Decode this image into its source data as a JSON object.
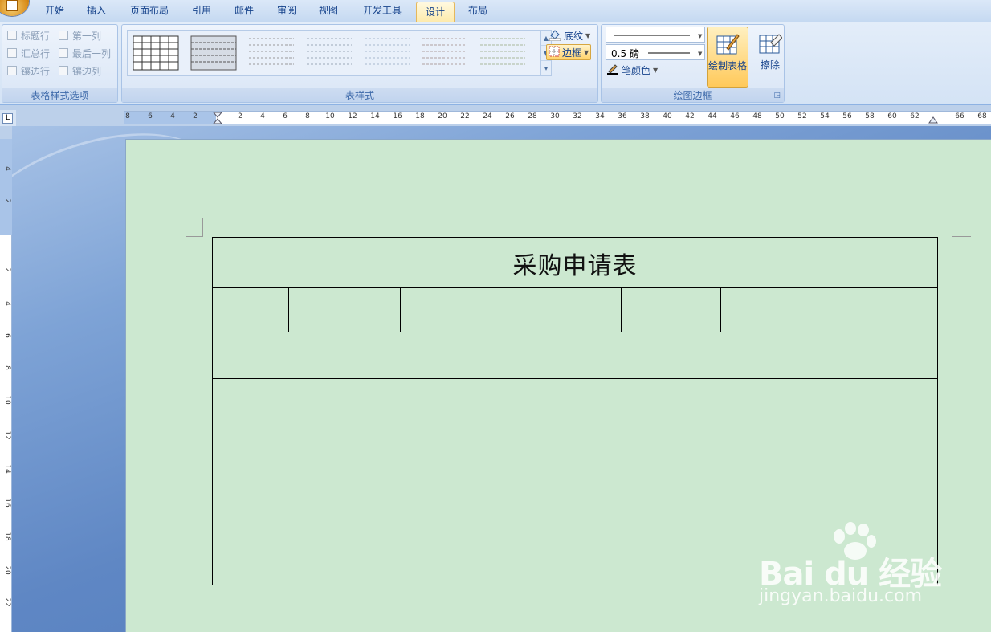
{
  "tabs": [
    {
      "label": "开始",
      "active": false
    },
    {
      "label": "插入",
      "active": false
    },
    {
      "label": "页面布局",
      "active": false
    },
    {
      "label": "引用",
      "active": false
    },
    {
      "label": "邮件",
      "active": false
    },
    {
      "label": "审阅",
      "active": false
    },
    {
      "label": "视图",
      "active": false
    },
    {
      "label": "开发工具",
      "active": false
    },
    {
      "label": "设计",
      "active": true
    },
    {
      "label": "布局",
      "active": false
    }
  ],
  "table_style_options": {
    "label": "表格样式选项",
    "options": [
      {
        "label": "标题行",
        "checked": false
      },
      {
        "label": "第一列",
        "checked": false
      },
      {
        "label": "汇总行",
        "checked": false
      },
      {
        "label": "最后一列",
        "checked": false
      },
      {
        "label": "镶边行",
        "checked": false
      },
      {
        "label": "镶边列",
        "checked": false
      }
    ]
  },
  "table_styles": {
    "label": "表样式",
    "shading_label": "底纹",
    "borders_label": "边框"
  },
  "draw_borders": {
    "label": "绘图边框",
    "line_weight": "0.5 磅",
    "pen_color_label": "笔颜色",
    "draw_table_label": "绘制表格",
    "eraser_label": "擦除"
  },
  "ruler": {
    "horizontal_ticks": [
      "8",
      "6",
      "4",
      "2",
      "2",
      "4",
      "6",
      "8",
      "10",
      "12",
      "14",
      "16",
      "18",
      "20",
      "22",
      "24",
      "26",
      "28",
      "30",
      "32",
      "34",
      "36",
      "38",
      "40",
      "42",
      "44",
      "46",
      "48",
      "50",
      "52",
      "54",
      "56",
      "58",
      "60",
      "62",
      "66",
      "68"
    ],
    "vertical_ticks": [
      "4",
      "2",
      "2",
      "4",
      "6",
      "8",
      "10",
      "12",
      "14",
      "16",
      "18",
      "20",
      "22"
    ]
  },
  "document": {
    "table_title": "采购申请表"
  },
  "watermark": {
    "brand": "Bai du 经验",
    "url": "jingyan.baidu.com"
  },
  "colors": {
    "page_background": "#cce8d0",
    "ribbon_background": "#dbe8f8",
    "selected_button": "#ffd36b"
  }
}
